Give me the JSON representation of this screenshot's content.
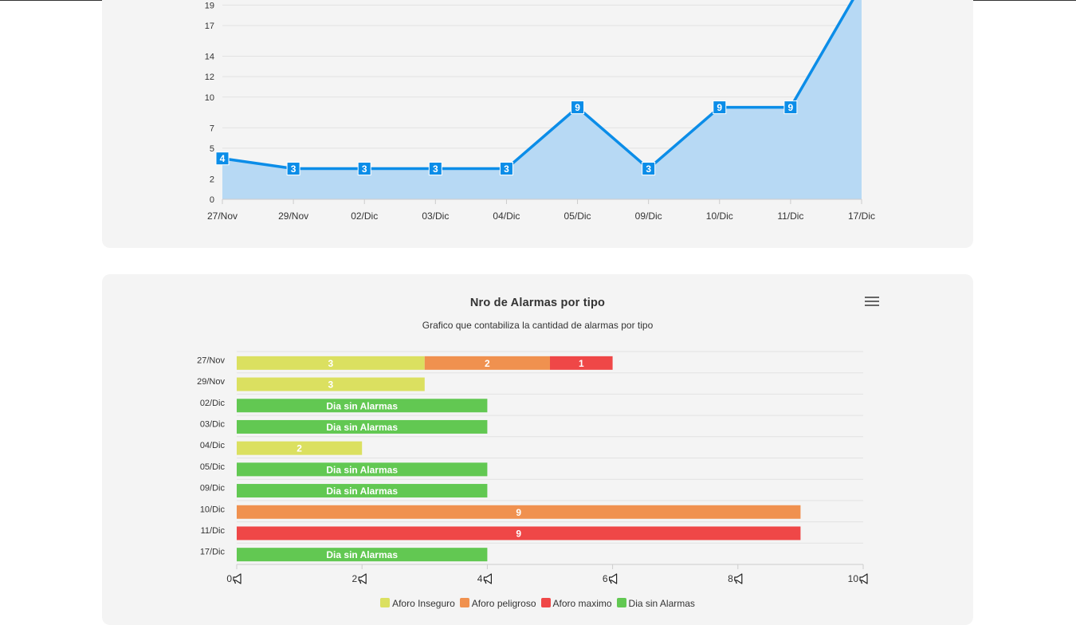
{
  "chart_data": [
    {
      "type": "area",
      "title": "",
      "xlabel": "",
      "ylabel": "",
      "categories": [
        "27/Nov",
        "29/Nov",
        "02/Dic",
        "03/Dic",
        "04/Dic",
        "05/Dic",
        "09/Dic",
        "10/Dic",
        "11/Dic",
        "17/Dic"
      ],
      "series": [
        {
          "values": [
            4,
            3,
            3,
            3,
            3,
            9,
            3,
            9,
            9,
            21
          ],
          "color": "#0b8de8",
          "fill": "#b7d9f4"
        }
      ],
      "data_labels": [
        "4",
        "3",
        "3",
        "3",
        "3",
        "9",
        "3",
        "9",
        "9",
        ""
      ],
      "y_ticks": [
        "0",
        "2",
        "5",
        "7",
        "10",
        "12",
        "14",
        "17",
        "19"
      ],
      "ylim": [
        0,
        19.5
      ],
      "grid": true
    },
    {
      "type": "bar",
      "orientation": "horizontal",
      "stacked": true,
      "title": "Nro de Alarmas por tipo",
      "subtitle": "Grafico que contabiliza la cantidad de alarmas por tipo",
      "categories": [
        "27/Nov",
        "29/Nov",
        "02/Dic",
        "03/Dic",
        "04/Dic",
        "05/Dic",
        "09/Dic",
        "10/Dic",
        "11/Dic",
        "17/Dic"
      ],
      "series": [
        {
          "name": "Aforo Inseguro",
          "color": "#dbe060",
          "values": [
            3,
            3,
            0,
            0,
            2,
            0,
            0,
            0,
            0,
            0
          ]
        },
        {
          "name": "Aforo peligroso",
          "color": "#f0914f",
          "values": [
            2,
            0,
            0,
            0,
            0,
            0,
            0,
            9,
            0,
            0
          ]
        },
        {
          "name": "Aforo maximo",
          "color": "#ef4747",
          "values": [
            1,
            0,
            0,
            0,
            0,
            0,
            0,
            0,
            9,
            0
          ]
        },
        {
          "name": "Dia sin Alarmas",
          "color": "#62c852",
          "values": [
            0,
            0,
            4,
            4,
            0,
            4,
            4,
            0,
            0,
            4
          ],
          "label": "Dia sin Alarmas"
        }
      ],
      "x_ticks": [
        "0",
        "2",
        "4",
        "6",
        "8",
        "10"
      ],
      "x_tick_suffix_icon": "megaphone-icon",
      "xlim": [
        0,
        10
      ],
      "legend": "bottom",
      "grid": true
    }
  ],
  "menu_icon": "hamburger-menu-icon"
}
